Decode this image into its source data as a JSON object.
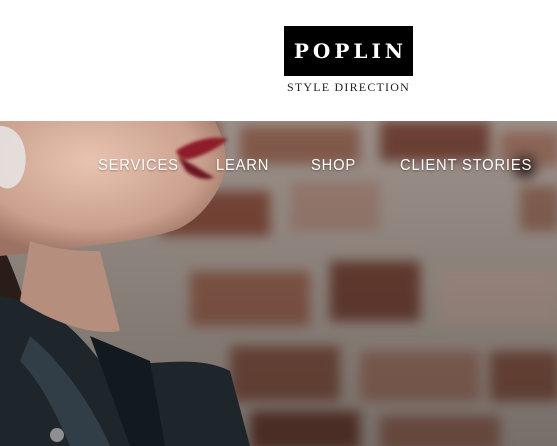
{
  "brand": {
    "logo": "POPLIN",
    "tagline": "STYLE DIRECTION"
  },
  "nav": {
    "items": [
      {
        "label": "SERVICES"
      },
      {
        "label": "LEARN"
      },
      {
        "label": "SHOP"
      },
      {
        "label": "CLIENT STORIES"
      }
    ]
  },
  "colors": {
    "logo_bg": "#000000",
    "logo_text": "#ffffff",
    "nav_text": "#ffffff",
    "brick": "#8a4f3d",
    "lips": "#8e1b2c",
    "jacket": "#1e262c"
  }
}
